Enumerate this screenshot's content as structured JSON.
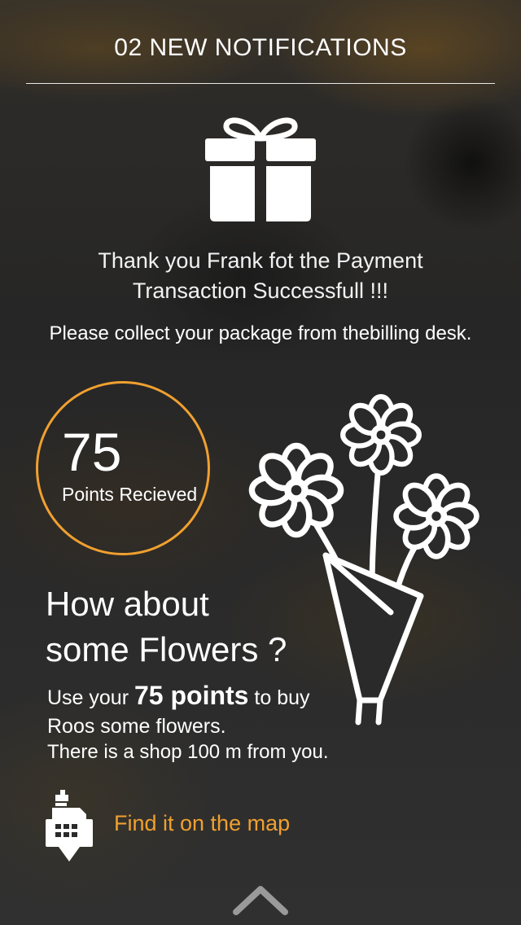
{
  "header": {
    "title": "02 NEW NOTIFICATIONS"
  },
  "notification": {
    "thanks_line1": "Thank you Frank fot the Payment",
    "thanks_line2": "Transaction Successfull !!!",
    "collect": "Please collect your package from thebilling desk."
  },
  "points": {
    "value": "75",
    "label": "Points Recieved",
    "ring_color": "#f0a030"
  },
  "offer": {
    "title_line1": "How about",
    "title_line2": "some Flowers ?",
    "use_prefix": "Use your",
    "use_points": "75 points",
    "use_suffix": "to buy",
    "roos_line": "Roos some flowers.",
    "shop_line": "There is a shop 100 m from you."
  },
  "map": {
    "link_text": "Find it on the map",
    "link_color": "#f0a030",
    "icon": "shop-map-pin-icon"
  },
  "icons": {
    "gift": "gift-icon",
    "flowers": "flower-bouquet-icon",
    "chevron": "chevron-up-icon"
  }
}
